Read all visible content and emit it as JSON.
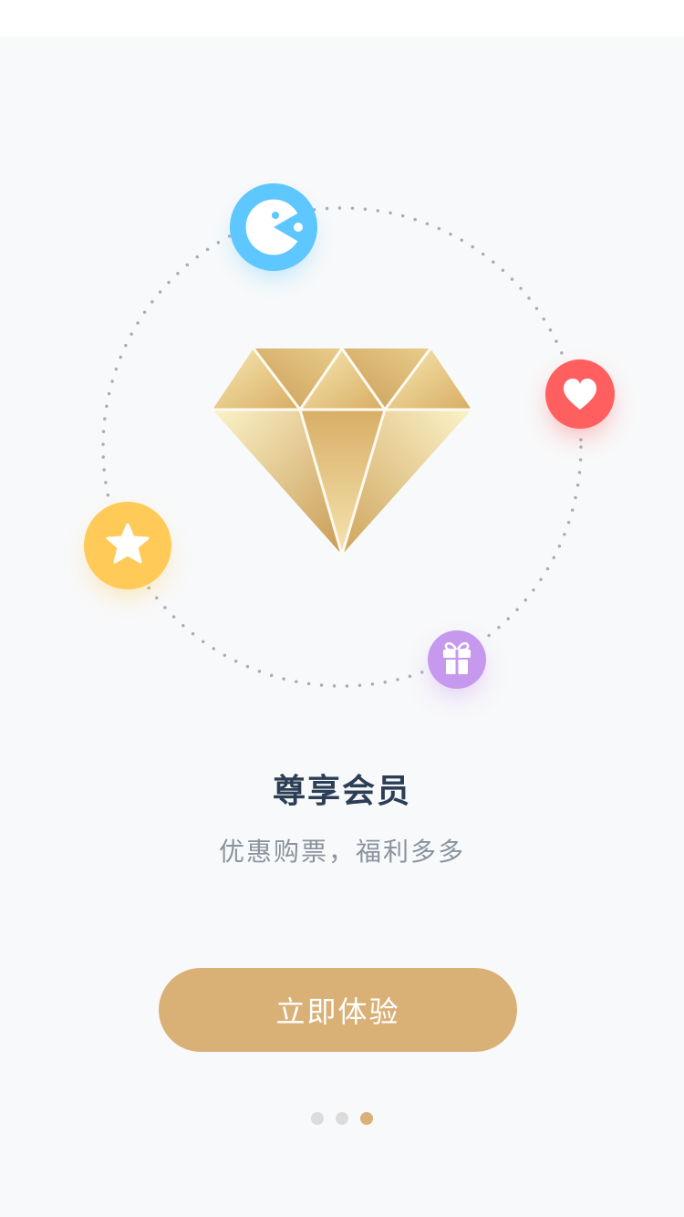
{
  "onboarding": {
    "title": "尊享会员",
    "subtitle": "优惠购票，福利多多",
    "cta_label": "立即体验"
  },
  "pagination": {
    "total": 3,
    "active_index": 2
  },
  "icons": {
    "top": "game-icon",
    "right": "heart-icon",
    "left": "star-icon",
    "bottom": "gift-icon",
    "center": "diamond-icon"
  },
  "colors": {
    "background": "#f8f9fa",
    "title": "#2c3e55",
    "subtitle": "#8a939e",
    "accent": "#d9b177",
    "icon_blue": "#5ec7ff",
    "icon_red": "#ff5f5f",
    "icon_yellow": "#ffca58",
    "icon_purple": "#c699ee",
    "dot_inactive": "#dcdcdc"
  }
}
